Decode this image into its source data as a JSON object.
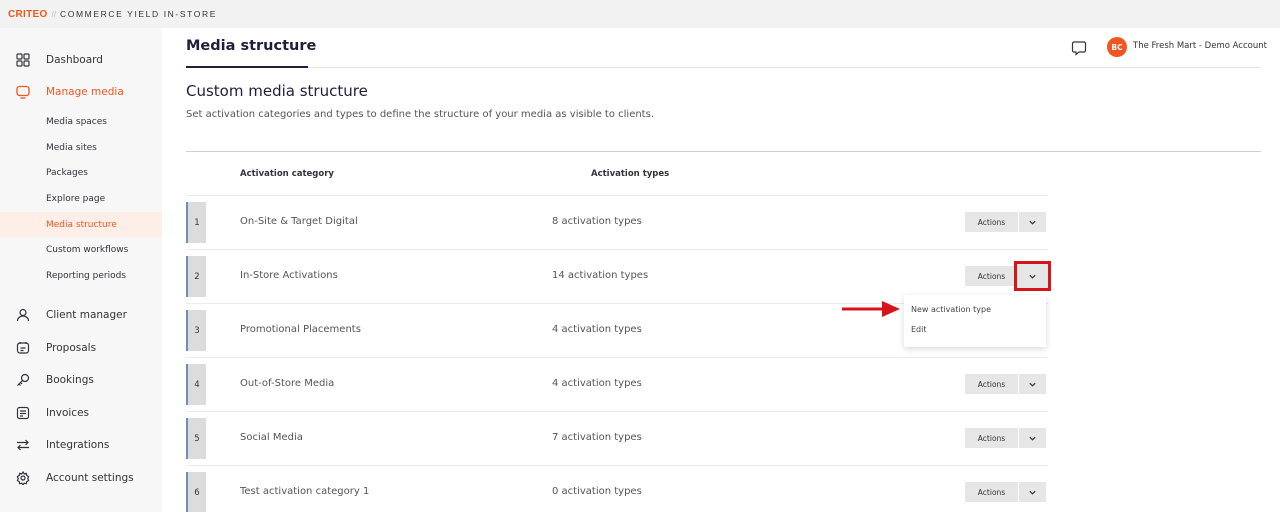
{
  "topbar": {
    "brand": "CRITEO",
    "separator": "//",
    "product": "COMMERCE YIELD IN-STORE"
  },
  "sidebar": {
    "items": [
      {
        "label": "Dashboard",
        "icon": "grid-icon"
      },
      {
        "label": "Manage media",
        "icon": "monitor-icon",
        "active": true
      },
      {
        "label": "Client manager",
        "icon": "user-icon"
      },
      {
        "label": "Proposals",
        "icon": "proposal-icon"
      },
      {
        "label": "Bookings",
        "icon": "key-icon"
      },
      {
        "label": "Invoices",
        "icon": "invoice-icon"
      },
      {
        "label": "Integrations",
        "icon": "swap-arrows-icon"
      },
      {
        "label": "Account settings",
        "icon": "gear-icon"
      }
    ],
    "sub_items": [
      {
        "label": "Media spaces"
      },
      {
        "label": "Media sites"
      },
      {
        "label": "Packages"
      },
      {
        "label": "Explore page"
      },
      {
        "label": "Media structure",
        "active": true
      },
      {
        "label": "Custom workflows"
      },
      {
        "label": "Reporting periods"
      }
    ]
  },
  "header": {
    "title": "Media structure",
    "avatar_initials": "BC",
    "account_name": "The Fresh Mart - Demo Account"
  },
  "section": {
    "title": "Custom media structure",
    "description": "Set activation categories and types to define the structure of your media as visible to clients."
  },
  "table": {
    "columns": [
      "Activation category",
      "Activation types"
    ],
    "actions_label": "Actions",
    "rows": [
      {
        "num": "1",
        "category": "On-Site & Target Digital",
        "types": "8 activation types"
      },
      {
        "num": "2",
        "category": "In-Store Activations",
        "types": "14 activation types"
      },
      {
        "num": "3",
        "category": "Promotional Placements",
        "types": "4 activation types"
      },
      {
        "num": "4",
        "category": "Out-of-Store Media",
        "types": "4 activation types"
      },
      {
        "num": "5",
        "category": "Social Media",
        "types": "7 activation types"
      },
      {
        "num": "6",
        "category": "Test activation category 1",
        "types": "0 activation types"
      }
    ]
  },
  "dropdown": {
    "items": [
      "New activation type",
      "Edit"
    ]
  },
  "colors": {
    "accent": "#f0561f",
    "highlight": "#d8141b",
    "title": "#1e1f3a"
  }
}
